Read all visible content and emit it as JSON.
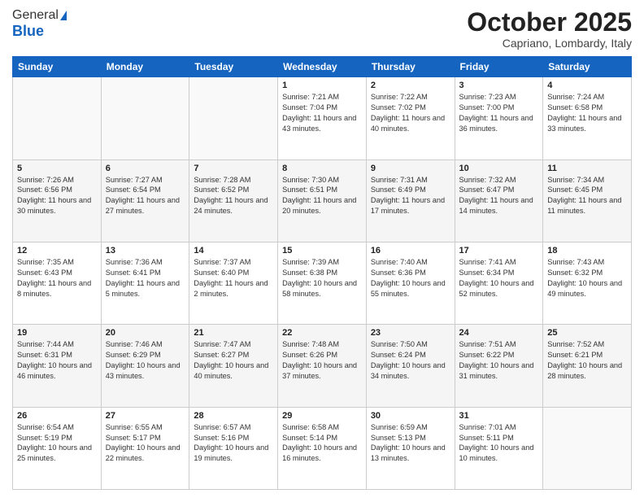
{
  "logo": {
    "general": "General",
    "blue": "Blue"
  },
  "header": {
    "month": "October 2025",
    "location": "Capriano, Lombardy, Italy"
  },
  "weekdays": [
    "Sunday",
    "Monday",
    "Tuesday",
    "Wednesday",
    "Thursday",
    "Friday",
    "Saturday"
  ],
  "weeks": [
    [
      {
        "day": "",
        "sunrise": "",
        "sunset": "",
        "daylight": ""
      },
      {
        "day": "",
        "sunrise": "",
        "sunset": "",
        "daylight": ""
      },
      {
        "day": "",
        "sunrise": "",
        "sunset": "",
        "daylight": ""
      },
      {
        "day": "1",
        "sunrise": "Sunrise: 7:21 AM",
        "sunset": "Sunset: 7:04 PM",
        "daylight": "Daylight: 11 hours and 43 minutes."
      },
      {
        "day": "2",
        "sunrise": "Sunrise: 7:22 AM",
        "sunset": "Sunset: 7:02 PM",
        "daylight": "Daylight: 11 hours and 40 minutes."
      },
      {
        "day": "3",
        "sunrise": "Sunrise: 7:23 AM",
        "sunset": "Sunset: 7:00 PM",
        "daylight": "Daylight: 11 hours and 36 minutes."
      },
      {
        "day": "4",
        "sunrise": "Sunrise: 7:24 AM",
        "sunset": "Sunset: 6:58 PM",
        "daylight": "Daylight: 11 hours and 33 minutes."
      }
    ],
    [
      {
        "day": "5",
        "sunrise": "Sunrise: 7:26 AM",
        "sunset": "Sunset: 6:56 PM",
        "daylight": "Daylight: 11 hours and 30 minutes."
      },
      {
        "day": "6",
        "sunrise": "Sunrise: 7:27 AM",
        "sunset": "Sunset: 6:54 PM",
        "daylight": "Daylight: 11 hours and 27 minutes."
      },
      {
        "day": "7",
        "sunrise": "Sunrise: 7:28 AM",
        "sunset": "Sunset: 6:52 PM",
        "daylight": "Daylight: 11 hours and 24 minutes."
      },
      {
        "day": "8",
        "sunrise": "Sunrise: 7:30 AM",
        "sunset": "Sunset: 6:51 PM",
        "daylight": "Daylight: 11 hours and 20 minutes."
      },
      {
        "day": "9",
        "sunrise": "Sunrise: 7:31 AM",
        "sunset": "Sunset: 6:49 PM",
        "daylight": "Daylight: 11 hours and 17 minutes."
      },
      {
        "day": "10",
        "sunrise": "Sunrise: 7:32 AM",
        "sunset": "Sunset: 6:47 PM",
        "daylight": "Daylight: 11 hours and 14 minutes."
      },
      {
        "day": "11",
        "sunrise": "Sunrise: 7:34 AM",
        "sunset": "Sunset: 6:45 PM",
        "daylight": "Daylight: 11 hours and 11 minutes."
      }
    ],
    [
      {
        "day": "12",
        "sunrise": "Sunrise: 7:35 AM",
        "sunset": "Sunset: 6:43 PM",
        "daylight": "Daylight: 11 hours and 8 minutes."
      },
      {
        "day": "13",
        "sunrise": "Sunrise: 7:36 AM",
        "sunset": "Sunset: 6:41 PM",
        "daylight": "Daylight: 11 hours and 5 minutes."
      },
      {
        "day": "14",
        "sunrise": "Sunrise: 7:37 AM",
        "sunset": "Sunset: 6:40 PM",
        "daylight": "Daylight: 11 hours and 2 minutes."
      },
      {
        "day": "15",
        "sunrise": "Sunrise: 7:39 AM",
        "sunset": "Sunset: 6:38 PM",
        "daylight": "Daylight: 10 hours and 58 minutes."
      },
      {
        "day": "16",
        "sunrise": "Sunrise: 7:40 AM",
        "sunset": "Sunset: 6:36 PM",
        "daylight": "Daylight: 10 hours and 55 minutes."
      },
      {
        "day": "17",
        "sunrise": "Sunrise: 7:41 AM",
        "sunset": "Sunset: 6:34 PM",
        "daylight": "Daylight: 10 hours and 52 minutes."
      },
      {
        "day": "18",
        "sunrise": "Sunrise: 7:43 AM",
        "sunset": "Sunset: 6:32 PM",
        "daylight": "Daylight: 10 hours and 49 minutes."
      }
    ],
    [
      {
        "day": "19",
        "sunrise": "Sunrise: 7:44 AM",
        "sunset": "Sunset: 6:31 PM",
        "daylight": "Daylight: 10 hours and 46 minutes."
      },
      {
        "day": "20",
        "sunrise": "Sunrise: 7:46 AM",
        "sunset": "Sunset: 6:29 PM",
        "daylight": "Daylight: 10 hours and 43 minutes."
      },
      {
        "day": "21",
        "sunrise": "Sunrise: 7:47 AM",
        "sunset": "Sunset: 6:27 PM",
        "daylight": "Daylight: 10 hours and 40 minutes."
      },
      {
        "day": "22",
        "sunrise": "Sunrise: 7:48 AM",
        "sunset": "Sunset: 6:26 PM",
        "daylight": "Daylight: 10 hours and 37 minutes."
      },
      {
        "day": "23",
        "sunrise": "Sunrise: 7:50 AM",
        "sunset": "Sunset: 6:24 PM",
        "daylight": "Daylight: 10 hours and 34 minutes."
      },
      {
        "day": "24",
        "sunrise": "Sunrise: 7:51 AM",
        "sunset": "Sunset: 6:22 PM",
        "daylight": "Daylight: 10 hours and 31 minutes."
      },
      {
        "day": "25",
        "sunrise": "Sunrise: 7:52 AM",
        "sunset": "Sunset: 6:21 PM",
        "daylight": "Daylight: 10 hours and 28 minutes."
      }
    ],
    [
      {
        "day": "26",
        "sunrise": "Sunrise: 6:54 AM",
        "sunset": "Sunset: 5:19 PM",
        "daylight": "Daylight: 10 hours and 25 minutes."
      },
      {
        "day": "27",
        "sunrise": "Sunrise: 6:55 AM",
        "sunset": "Sunset: 5:17 PM",
        "daylight": "Daylight: 10 hours and 22 minutes."
      },
      {
        "day": "28",
        "sunrise": "Sunrise: 6:57 AM",
        "sunset": "Sunset: 5:16 PM",
        "daylight": "Daylight: 10 hours and 19 minutes."
      },
      {
        "day": "29",
        "sunrise": "Sunrise: 6:58 AM",
        "sunset": "Sunset: 5:14 PM",
        "daylight": "Daylight: 10 hours and 16 minutes."
      },
      {
        "day": "30",
        "sunrise": "Sunrise: 6:59 AM",
        "sunset": "Sunset: 5:13 PM",
        "daylight": "Daylight: 10 hours and 13 minutes."
      },
      {
        "day": "31",
        "sunrise": "Sunrise: 7:01 AM",
        "sunset": "Sunset: 5:11 PM",
        "daylight": "Daylight: 10 hours and 10 minutes."
      },
      {
        "day": "",
        "sunrise": "",
        "sunset": "",
        "daylight": ""
      }
    ]
  ]
}
